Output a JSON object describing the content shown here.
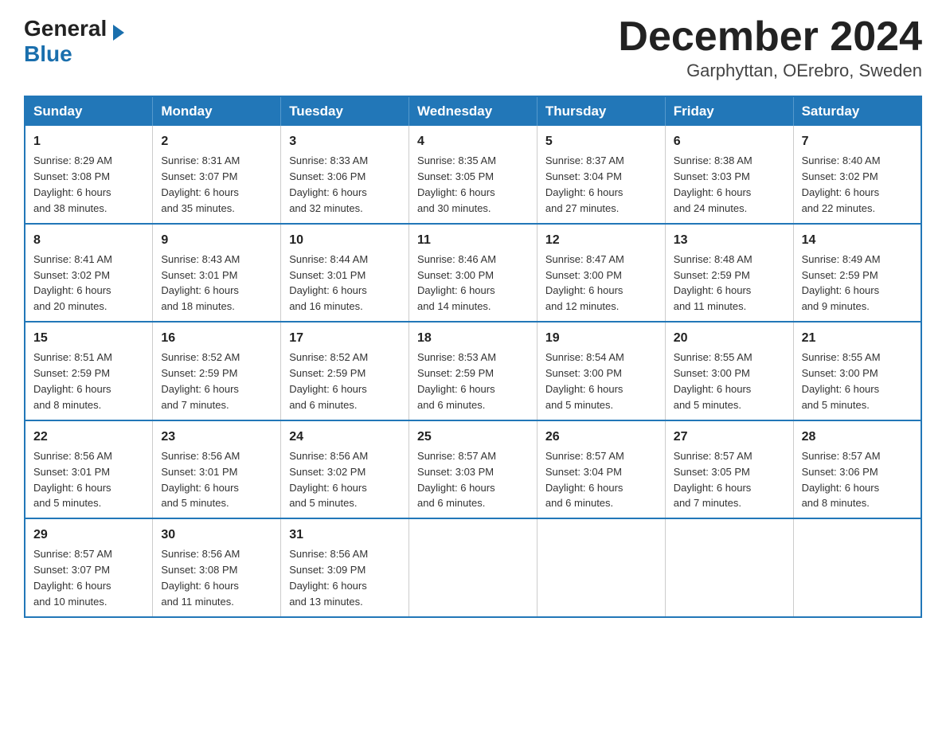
{
  "header": {
    "logo_general": "General",
    "logo_blue": "Blue",
    "title": "December 2024",
    "location": "Garphyttan, OErebro, Sweden"
  },
  "weekdays": [
    "Sunday",
    "Monday",
    "Tuesday",
    "Wednesday",
    "Thursday",
    "Friday",
    "Saturday"
  ],
  "weeks": [
    [
      {
        "day": "1",
        "sunrise": "8:29 AM",
        "sunset": "3:08 PM",
        "daylight": "6 hours and 38 minutes."
      },
      {
        "day": "2",
        "sunrise": "8:31 AM",
        "sunset": "3:07 PM",
        "daylight": "6 hours and 35 minutes."
      },
      {
        "day": "3",
        "sunrise": "8:33 AM",
        "sunset": "3:06 PM",
        "daylight": "6 hours and 32 minutes."
      },
      {
        "day": "4",
        "sunrise": "8:35 AM",
        "sunset": "3:05 PM",
        "daylight": "6 hours and 30 minutes."
      },
      {
        "day": "5",
        "sunrise": "8:37 AM",
        "sunset": "3:04 PM",
        "daylight": "6 hours and 27 minutes."
      },
      {
        "day": "6",
        "sunrise": "8:38 AM",
        "sunset": "3:03 PM",
        "daylight": "6 hours and 24 minutes."
      },
      {
        "day": "7",
        "sunrise": "8:40 AM",
        "sunset": "3:02 PM",
        "daylight": "6 hours and 22 minutes."
      }
    ],
    [
      {
        "day": "8",
        "sunrise": "8:41 AM",
        "sunset": "3:02 PM",
        "daylight": "6 hours and 20 minutes."
      },
      {
        "day": "9",
        "sunrise": "8:43 AM",
        "sunset": "3:01 PM",
        "daylight": "6 hours and 18 minutes."
      },
      {
        "day": "10",
        "sunrise": "8:44 AM",
        "sunset": "3:01 PM",
        "daylight": "6 hours and 16 minutes."
      },
      {
        "day": "11",
        "sunrise": "8:46 AM",
        "sunset": "3:00 PM",
        "daylight": "6 hours and 14 minutes."
      },
      {
        "day": "12",
        "sunrise": "8:47 AM",
        "sunset": "3:00 PM",
        "daylight": "6 hours and 12 minutes."
      },
      {
        "day": "13",
        "sunrise": "8:48 AM",
        "sunset": "2:59 PM",
        "daylight": "6 hours and 11 minutes."
      },
      {
        "day": "14",
        "sunrise": "8:49 AM",
        "sunset": "2:59 PM",
        "daylight": "6 hours and 9 minutes."
      }
    ],
    [
      {
        "day": "15",
        "sunrise": "8:51 AM",
        "sunset": "2:59 PM",
        "daylight": "6 hours and 8 minutes."
      },
      {
        "day": "16",
        "sunrise": "8:52 AM",
        "sunset": "2:59 PM",
        "daylight": "6 hours and 7 minutes."
      },
      {
        "day": "17",
        "sunrise": "8:52 AM",
        "sunset": "2:59 PM",
        "daylight": "6 hours and 6 minutes."
      },
      {
        "day": "18",
        "sunrise": "8:53 AM",
        "sunset": "2:59 PM",
        "daylight": "6 hours and 6 minutes."
      },
      {
        "day": "19",
        "sunrise": "8:54 AM",
        "sunset": "3:00 PM",
        "daylight": "6 hours and 5 minutes."
      },
      {
        "day": "20",
        "sunrise": "8:55 AM",
        "sunset": "3:00 PM",
        "daylight": "6 hours and 5 minutes."
      },
      {
        "day": "21",
        "sunrise": "8:55 AM",
        "sunset": "3:00 PM",
        "daylight": "6 hours and 5 minutes."
      }
    ],
    [
      {
        "day": "22",
        "sunrise": "8:56 AM",
        "sunset": "3:01 PM",
        "daylight": "6 hours and 5 minutes."
      },
      {
        "day": "23",
        "sunrise": "8:56 AM",
        "sunset": "3:01 PM",
        "daylight": "6 hours and 5 minutes."
      },
      {
        "day": "24",
        "sunrise": "8:56 AM",
        "sunset": "3:02 PM",
        "daylight": "6 hours and 5 minutes."
      },
      {
        "day": "25",
        "sunrise": "8:57 AM",
        "sunset": "3:03 PM",
        "daylight": "6 hours and 6 minutes."
      },
      {
        "day": "26",
        "sunrise": "8:57 AM",
        "sunset": "3:04 PM",
        "daylight": "6 hours and 6 minutes."
      },
      {
        "day": "27",
        "sunrise": "8:57 AM",
        "sunset": "3:05 PM",
        "daylight": "6 hours and 7 minutes."
      },
      {
        "day": "28",
        "sunrise": "8:57 AM",
        "sunset": "3:06 PM",
        "daylight": "6 hours and 8 minutes."
      }
    ],
    [
      {
        "day": "29",
        "sunrise": "8:57 AM",
        "sunset": "3:07 PM",
        "daylight": "6 hours and 10 minutes."
      },
      {
        "day": "30",
        "sunrise": "8:56 AM",
        "sunset": "3:08 PM",
        "daylight": "6 hours and 11 minutes."
      },
      {
        "day": "31",
        "sunrise": "8:56 AM",
        "sunset": "3:09 PM",
        "daylight": "6 hours and 13 minutes."
      },
      null,
      null,
      null,
      null
    ]
  ],
  "labels": {
    "sunrise": "Sunrise:",
    "sunset": "Sunset:",
    "daylight": "Daylight:"
  }
}
